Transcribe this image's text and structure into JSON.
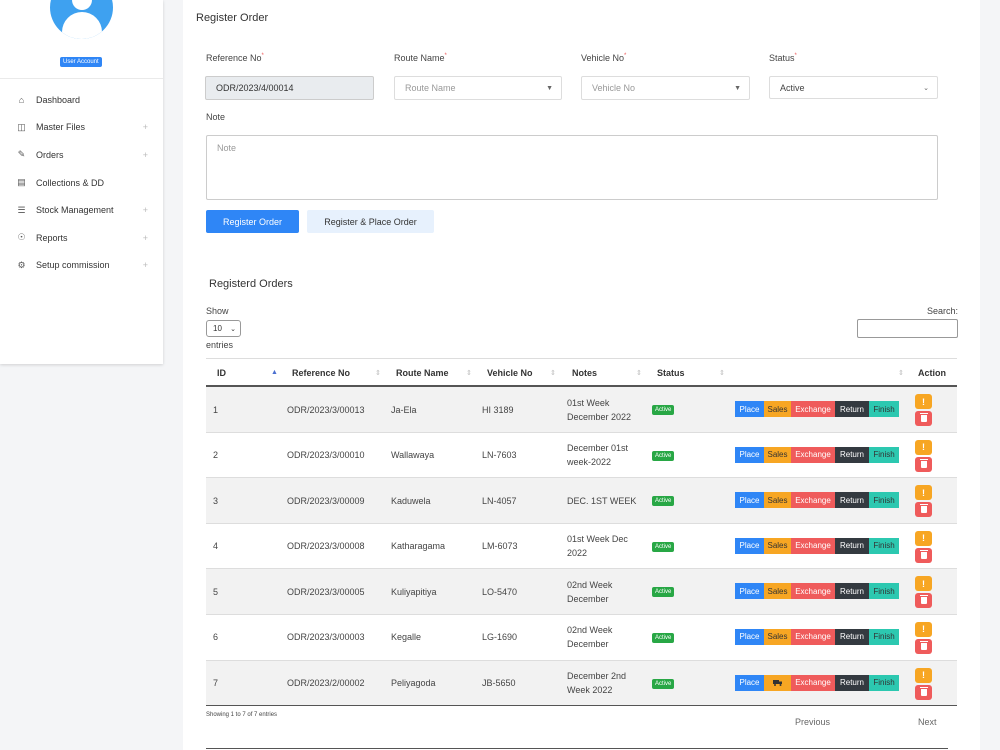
{
  "sidebar": {
    "user_badge": "User Account",
    "items": [
      {
        "label": "Dashboard",
        "icon": "home-icon",
        "expandable": false
      },
      {
        "label": "Master Files",
        "icon": "folder-icon",
        "expandable": true
      },
      {
        "label": "Orders",
        "icon": "pencil-icon",
        "expandable": true
      },
      {
        "label": "Collections & DD",
        "icon": "document-icon",
        "expandable": false
      },
      {
        "label": "Stock Management",
        "icon": "database-icon",
        "expandable": true
      },
      {
        "label": "Reports",
        "icon": "eye-icon",
        "expandable": true
      },
      {
        "label": "Setup commission",
        "icon": "gear-icon",
        "expandable": true
      }
    ],
    "plus": "+"
  },
  "form": {
    "title": "Register Order",
    "reference": {
      "label": "Reference No",
      "value": "ODR/2023/4/00014"
    },
    "route": {
      "label": "Route Name",
      "placeholder": "Route Name"
    },
    "vehicle": {
      "label": "Vehicle No",
      "placeholder": "Vehicle No"
    },
    "status": {
      "label": "Status",
      "value": "Active"
    },
    "required_mark": "*",
    "note": {
      "label": "Note",
      "placeholder": "Note"
    },
    "register_button": "Register Order",
    "register_place_button": "Register & Place Order"
  },
  "list": {
    "title": "Registerd Orders",
    "show_label": "Show",
    "entries_value": "10",
    "entries_label": "entries",
    "search_label": "Search:",
    "columns": [
      "ID",
      "Reference No",
      "Route Name",
      "Vehicle No",
      "Notes",
      "Status",
      "",
      "Action"
    ],
    "rows": [
      {
        "id": "1",
        "ref": "ODR/2023/3/00013",
        "route": "Ja-Ela",
        "vehicle": "HI 3189",
        "notes": "01st Week December 2022",
        "status": "Active",
        "sales": "Sales"
      },
      {
        "id": "2",
        "ref": "ODR/2023/3/00010",
        "route": "Wallawaya",
        "vehicle": "LN-7603",
        "notes": "December 01st week-2022",
        "status": "Active",
        "sales": "Sales"
      },
      {
        "id": "3",
        "ref": "ODR/2023/3/00009",
        "route": "Kaduwela",
        "vehicle": "LN-4057",
        "notes": "DEC. 1ST WEEK",
        "status": "Active",
        "sales": "Sales"
      },
      {
        "id": "4",
        "ref": "ODR/2023/3/00008",
        "route": "Katharagama",
        "vehicle": "LM-6073",
        "notes": "01st Week Dec 2022",
        "status": "Active",
        "sales": "Sales"
      },
      {
        "id": "5",
        "ref": "ODR/2023/3/00005",
        "route": "Kuliyapitiya",
        "vehicle": "LO-5470",
        "notes": "02nd Week December",
        "status": "Active",
        "sales": "Sales"
      },
      {
        "id": "6",
        "ref": "ODR/2023/3/00003",
        "route": "Kegalle",
        "vehicle": "LG-1690",
        "notes": "02nd Week December",
        "status": "Active",
        "sales": "Sales"
      },
      {
        "id": "7",
        "ref": "ODR/2023/2/00002",
        "route": "Peliyagoda",
        "vehicle": "JB-5650",
        "notes": "December 2nd Week 2022",
        "status": "Active",
        "sales": "truck-icon"
      }
    ],
    "actions": {
      "place": "Place",
      "exchange": "Exchange",
      "return": "Return",
      "finish": "Finish",
      "warn": "!"
    },
    "info": "Showing 1 to 7 of 7 entries",
    "previous": "Previous",
    "next": "Next"
  },
  "colors": {
    "primary": "#2f86f6",
    "success": "#28a745",
    "warning": "#f7a623",
    "danger": "#ef5b5b",
    "dark": "#343a40",
    "teal": "#2cc8b0"
  }
}
